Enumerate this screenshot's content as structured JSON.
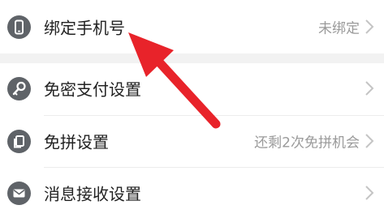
{
  "settings": {
    "items": [
      {
        "label": "绑定手机号",
        "value": "未绑定",
        "icon": "phone-icon"
      },
      {
        "label": "免密支付设置",
        "value": "",
        "icon": "key-icon"
      },
      {
        "label": "免拼设置",
        "value": "还剩2次免拼机会",
        "icon": "copy-icon"
      },
      {
        "label": "消息接收设置",
        "value": "",
        "icon": "mail-icon"
      }
    ]
  },
  "colors": {
    "icon_bg": "#5f6368",
    "arrow": "#e8232a",
    "value_text": "#9a9a9a",
    "label_text": "#222222"
  }
}
